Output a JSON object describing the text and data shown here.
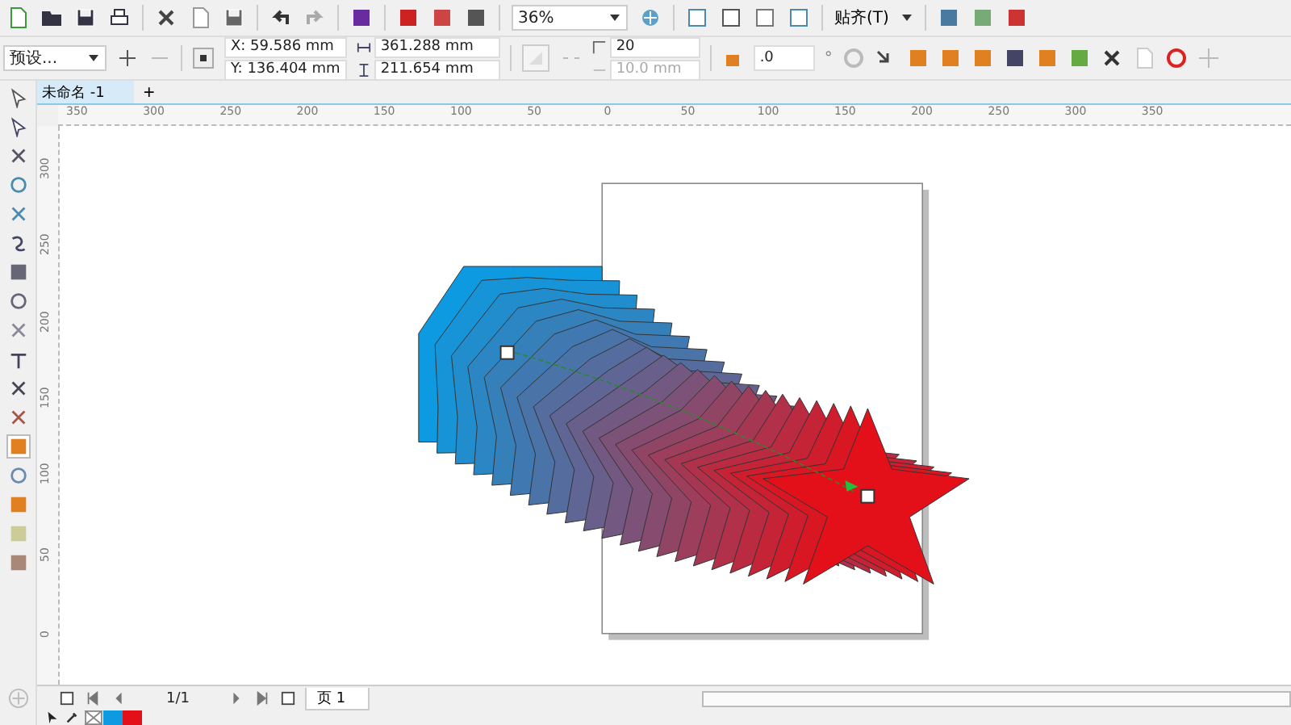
{
  "toolbar": {
    "zoom": "36%",
    "snap_menu": "贴齐(T)"
  },
  "property_bar": {
    "preset": "预设...",
    "x": "X: 59.586 mm",
    "y": "Y: 136.404 mm",
    "width": "361.288 mm",
    "height": "211.654 mm",
    "steps": "20",
    "spacing": "10.0 mm",
    "angle": ".0",
    "degree_sign": "°"
  },
  "document_tabs": [
    {
      "label": "未命名 -1",
      "selected": true
    }
  ],
  "add_tab": "+",
  "horizontal_ruler": [
    "350",
    "300",
    "250",
    "200",
    "150",
    "100",
    "50",
    "0",
    "50",
    "100",
    "150",
    "200",
    "250",
    "300",
    "350"
  ],
  "vertical_ruler": [
    "300",
    "250",
    "200",
    "150",
    "100",
    "50",
    "0"
  ],
  "page_nav": {
    "counter": "1/1",
    "page_tab": "页 1"
  },
  "palette": [
    {
      "color": "#0d9ae0"
    },
    {
      "color": "#e3101a"
    }
  ]
}
